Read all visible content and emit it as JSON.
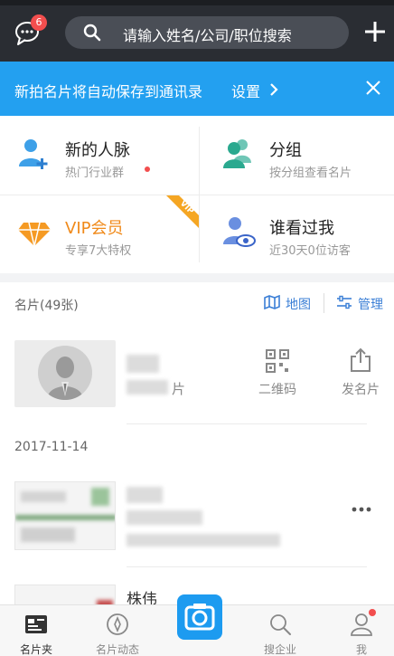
{
  "header": {
    "chat_badge": "6",
    "search_placeholder": "请输入姓名/公司/职位搜索"
  },
  "banner": {
    "message": "新拍名片将自动保存到通讯录",
    "setting_label": "设置"
  },
  "quick": {
    "contacts": {
      "title": "新的人脉",
      "subtitle": "热门行业群"
    },
    "groups": {
      "title": "分组",
      "subtitle": "按分组查看名片"
    },
    "vip": {
      "title": "VIP会员",
      "subtitle": "专享7大特权",
      "ribbon": "VIP"
    },
    "visitors": {
      "title": "谁看过我",
      "subtitle": "近30天0位访客"
    }
  },
  "cards": {
    "count_label": "名片(49张)",
    "map_label": "地图",
    "manage_label": "管理",
    "my_card_suffix": "片",
    "qr_label": "二维码",
    "send_label": "发名片",
    "date": "2017-11-14",
    "card2_name_fragment": "株伟"
  },
  "nav": {
    "items": [
      {
        "label": "名片夹",
        "icon": "card-folder-icon"
      },
      {
        "label": "名片动态",
        "icon": "compass-icon"
      },
      {
        "label": "",
        "icon": "camera-icon"
      },
      {
        "label": "搜企业",
        "icon": "search-icon"
      },
      {
        "label": "我",
        "icon": "person-icon"
      }
    ]
  },
  "colors": {
    "topbar": "#2a2d33",
    "banner": "#23a0f0",
    "accent": "#3b7fd6",
    "vip": "#f59a23",
    "badge": "#f24e4e"
  }
}
